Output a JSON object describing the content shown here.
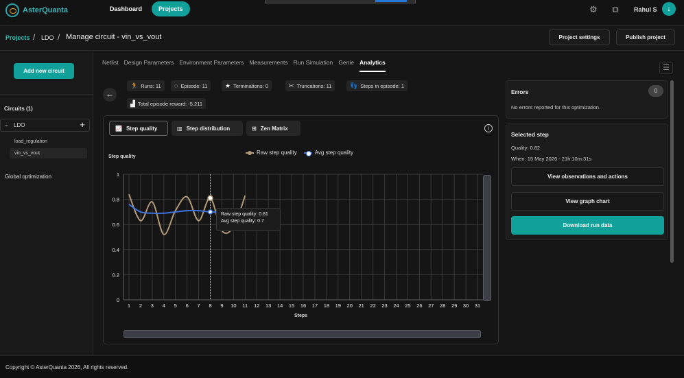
{
  "header": {
    "logo_text": "AsterQuanta",
    "nav": [
      {
        "label": "Dashboard"
      },
      {
        "label": "Projects"
      }
    ],
    "user_name": "Rahul S",
    "avatar_icon": "download-icon"
  },
  "breadcrumb": {
    "projects": "Projects",
    "sep": "/",
    "ldo": "LDO",
    "title": "Manage circuit - vin_vs_vout"
  },
  "actions": {
    "project_settings": "Project settings",
    "publish_project": "Publish project"
  },
  "sidebar": {
    "add_circuit": "Add new circuit",
    "circuits_heading": "Circuits (1)",
    "circuit_name": "LDO",
    "children": [
      {
        "label": "load_regulation"
      },
      {
        "label": "vin_vs_vout"
      }
    ],
    "global_optimization": "Global optimization"
  },
  "tabs": [
    {
      "label": "Netlist"
    },
    {
      "label": "Design Parameters"
    },
    {
      "label": "Environment Parameters"
    },
    {
      "label": "Measurements"
    },
    {
      "label": "Run Simulation"
    },
    {
      "label": "Genie"
    },
    {
      "label": "Analytics"
    }
  ],
  "stats": {
    "runs": "Runs: 11",
    "episode": "Episode: 11",
    "terminations": "Terminations: 0",
    "truncations": "Truncations: 11",
    "steps_in_episode": "Steps in episode: 1",
    "total_reward": "Total episode reward: -5.211"
  },
  "chart_tabs": [
    {
      "label": "Step quality"
    },
    {
      "label": "Step distribution"
    },
    {
      "label": "Zen Matrix"
    }
  ],
  "tooltip": {
    "raw": "Raw step quality: 0.81",
    "avg": "Avg step quality: 0.7"
  },
  "chart_data": {
    "type": "line",
    "ylabel": "Step quality",
    "xlabel": "Steps",
    "ylim": [
      0,
      1
    ],
    "yticks": [
      "0",
      "0.2",
      "0.4",
      "0.6",
      "0.8",
      "1"
    ],
    "x": [
      1,
      2,
      3,
      4,
      5,
      6,
      7,
      8,
      9,
      10,
      11,
      12,
      13,
      14,
      15,
      16,
      17,
      18,
      19,
      20,
      21,
      22,
      23,
      24,
      25,
      26,
      27,
      28,
      29,
      30,
      31
    ],
    "grid": true,
    "legend_position": "top",
    "series": [
      {
        "name": "Raw step quality",
        "color": "#b39a78",
        "values": [
          0.84,
          0.63,
          0.78,
          0.52,
          0.71,
          0.82,
          0.63,
          0.81,
          0.55,
          0.58,
          0.83
        ]
      },
      {
        "name": "Avg step quality",
        "color": "#3e74e0",
        "values": [
          0.76,
          0.7,
          0.69,
          0.69,
          0.7,
          0.71,
          0.71,
          0.7,
          0.7,
          null,
          null
        ]
      }
    ]
  },
  "errors": {
    "title": "Errors",
    "count": "0",
    "message": "No errors reported for this optimization."
  },
  "selected_step": {
    "title": "Selected step",
    "quality": "Quality: 0.82",
    "when": "When: 15 May 2026 - 21h:10m:31s",
    "view_obs": "View observations and actions",
    "view_graph": "View graph chart",
    "download": "Download run data"
  },
  "footer": {
    "copyright": "Copyright © AsterQuanta 2026, All rights reserved."
  }
}
